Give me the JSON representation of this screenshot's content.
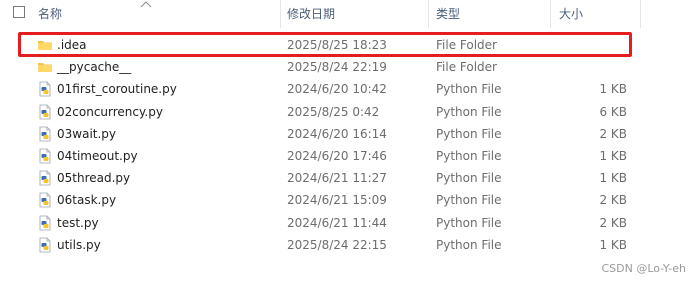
{
  "columns": {
    "name": "名称",
    "date": "修改日期",
    "type": "类型",
    "size": "大小"
  },
  "files": [
    {
      "name": ".idea",
      "date": "2025/8/25 18:23",
      "type": "File Folder",
      "size": "",
      "icon": "folder-icon"
    },
    {
      "name": "__pycache__",
      "date": "2025/8/24 22:19",
      "type": "File Folder",
      "size": "",
      "icon": "folder-icon"
    },
    {
      "name": "01first_coroutine.py",
      "date": "2024/6/20 10:42",
      "type": "Python File",
      "size": "1 KB",
      "icon": "python-file-icon"
    },
    {
      "name": "02concurrency.py",
      "date": "2025/8/25 0:42",
      "type": "Python File",
      "size": "6 KB",
      "icon": "python-file-icon"
    },
    {
      "name": "03wait.py",
      "date": "2024/6/20 16:14",
      "type": "Python File",
      "size": "2 KB",
      "icon": "python-file-icon"
    },
    {
      "name": "04timeout.py",
      "date": "2024/6/20 17:46",
      "type": "Python File",
      "size": "1 KB",
      "icon": "python-file-icon"
    },
    {
      "name": "05thread.py",
      "date": "2024/6/21 11:27",
      "type": "Python File",
      "size": "1 KB",
      "icon": "python-file-icon"
    },
    {
      "name": "06task.py",
      "date": "2024/6/21 15:09",
      "type": "Python File",
      "size": "2 KB",
      "icon": "python-file-icon"
    },
    {
      "name": "test.py",
      "date": "2024/6/21 11:44",
      "type": "Python File",
      "size": "2 KB",
      "icon": "python-file-icon"
    },
    {
      "name": "utils.py",
      "date": "2025/8/24 22:15",
      "type": "Python File",
      "size": "1 KB",
      "icon": "python-file-icon"
    }
  ],
  "highlight_color": "#e41e1e",
  "watermark": "CSDN @Lo-Y-eh"
}
